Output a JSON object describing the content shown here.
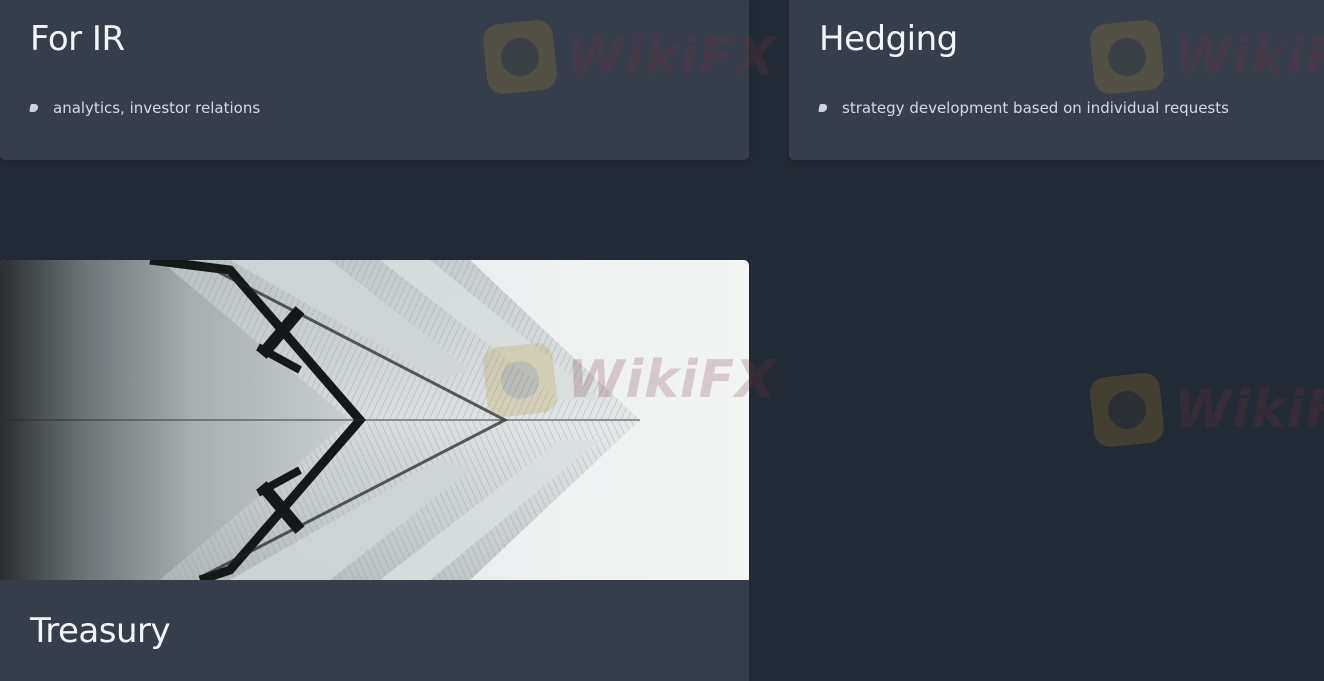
{
  "cards": {
    "ir": {
      "title": "For IR",
      "bullets": [
        "analytics, investor relations"
      ]
    },
    "hedging": {
      "title": "Hedging",
      "bullets": [
        "strategy development based on individual requests"
      ]
    },
    "treasury": {
      "title": "Treasury",
      "image": "architecture-photo"
    }
  },
  "watermark": {
    "text": "WikiFX"
  },
  "colors": {
    "background": "#222a36",
    "card": "#363e4b",
    "title": "#f3f5f8",
    "text": "#d5d9df"
  }
}
